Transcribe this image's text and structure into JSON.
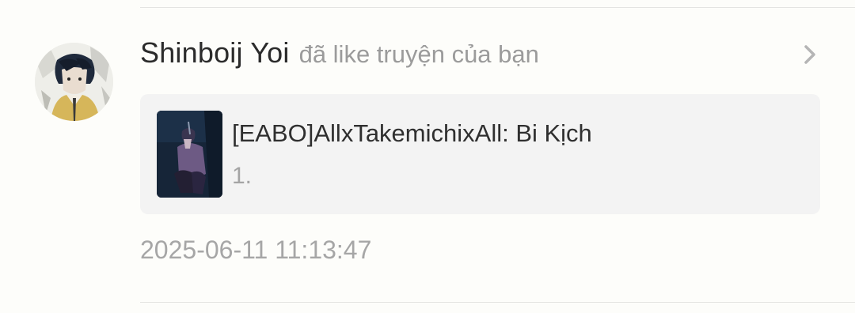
{
  "notification": {
    "user_name": "Shinboij Yoi",
    "action": "đã like truyện của bạn",
    "avatar_icon": "user-avatar-image",
    "chevron_icon": "chevron-right-icon",
    "story": {
      "title": "[EABO]AllxTakemichixAll: Bi Kịch",
      "chapter": "1.",
      "cover_icon": "story-cover-image"
    },
    "timestamp": "2025-06-11 11:13:47"
  },
  "colors": {
    "background": "#fdfdfa",
    "user_name": "#2b2b2b",
    "secondary_text": "#9b9b9b",
    "card_background": "#f3f3f3",
    "chevron": "#b5b5b5"
  }
}
